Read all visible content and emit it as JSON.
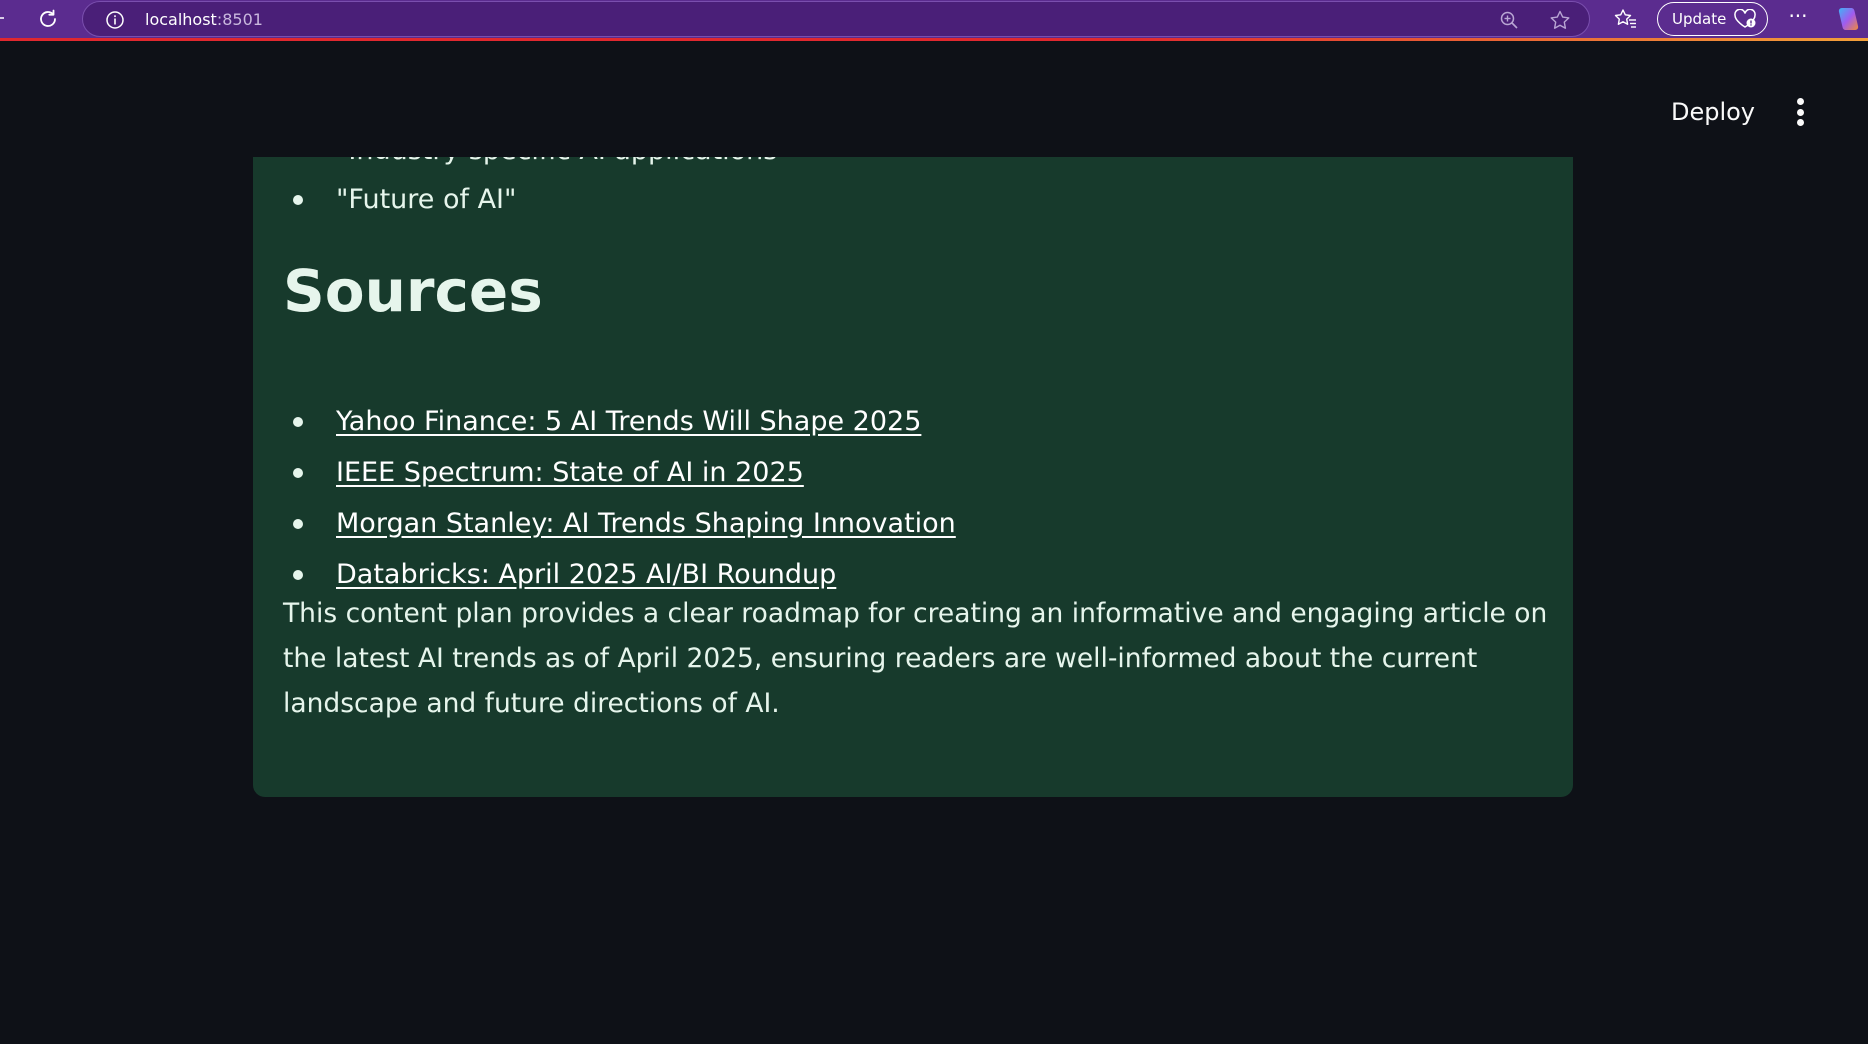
{
  "browser": {
    "url_host": "localhost",
    "url_port": ":8501",
    "update_label": "Update",
    "more_label": "···"
  },
  "app_header": {
    "deploy_label": "Deploy"
  },
  "content": {
    "prev_list": [
      "\"Industry-specific AI applications\"",
      "\"Future of AI\""
    ],
    "sources_heading": "Sources",
    "sources": [
      "Yahoo Finance: 5 AI Trends Will Shape 2025",
      "IEEE Spectrum: State of AI in 2025",
      "Morgan Stanley: AI Trends Shaping Innovation",
      "Databricks: April 2025 AI/BI Roundup"
    ],
    "closing_paragraph": "This content plan provides a clear roadmap for creating an informative and engaging article on the latest AI trends as of April 2025, ensuring readers are well-informed about the current landscape and future directions of AI."
  },
  "colors": {
    "browser_bar": "#5b2c8f",
    "page_bg": "#0e1117",
    "card_bg": "#173a2c",
    "text": "#e6f5ec"
  }
}
